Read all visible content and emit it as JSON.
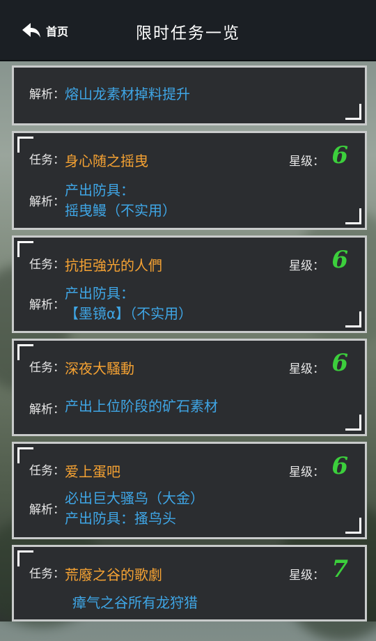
{
  "header": {
    "back_label": "首页",
    "title": "限时任务一览"
  },
  "labels": {
    "task": "任务：",
    "analysis": "解析：",
    "star": "星级："
  },
  "cards": [
    {
      "analysis": [
        "熔山龙素材掉料提升"
      ]
    },
    {
      "task": "身心随之摇曳",
      "star": "6",
      "analysis": [
        "产出防具：",
        "摇曳鳗（不实用）"
      ]
    },
    {
      "task": "抗拒強光的人們",
      "star": "6",
      "analysis": [
        "产出防具：",
        "【墨镜α】（不实用）"
      ]
    },
    {
      "task": "深夜大騷動",
      "star": "6",
      "analysis": [
        "产出上位阶段的矿石素材"
      ]
    },
    {
      "task": "爱上蛋吧",
      "star": "6",
      "analysis": [
        "必出巨大骚鸟（大金）",
        "产出防具：搔鸟头"
      ]
    },
    {
      "task": "荒廢之谷的歌劇",
      "star": "7",
      "analysis": [
        "瘴气之谷所有龙狩猎"
      ]
    }
  ],
  "colors": {
    "task": "#f5a233",
    "analysis": "#3fa6e6",
    "star": "#3ccf3c",
    "header": "#1b1f24",
    "card": "#2b2d30"
  },
  "icons": {
    "back": "back-arrow-icon"
  }
}
